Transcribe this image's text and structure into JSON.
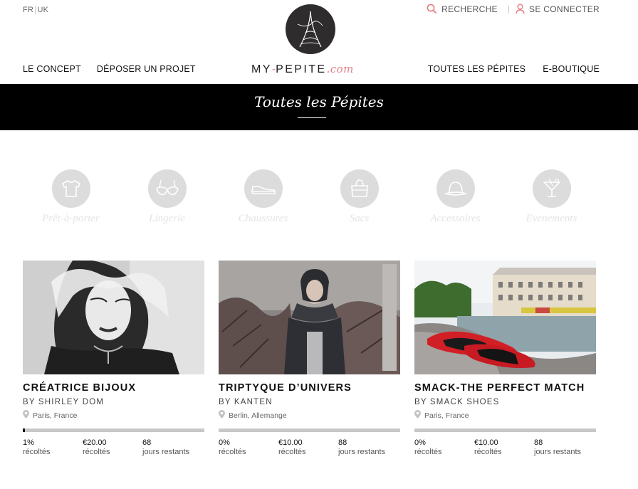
{
  "header": {
    "lang_fr": "FR",
    "lang_sep": "|",
    "lang_uk": "UK",
    "search_label": "RECHERCHE",
    "util_sep": "|",
    "login_label": "SE CONNECTER",
    "logo_main": "MY",
    "logo_dash": "-",
    "logo_rest": "PEPITE",
    "logo_com": ".com",
    "nav_left": [
      "LE CONCEPT",
      "DÉPOSER UN PROJET"
    ],
    "nav_right": [
      "TOUTES LES PÉPITES",
      "E-BOUTIQUE"
    ]
  },
  "banner": {
    "title": "Toutes les Pépites"
  },
  "categories": [
    {
      "label": "Prêt-à-porter",
      "icon": "tshirt-icon"
    },
    {
      "label": "Lingerie",
      "icon": "bra-icon"
    },
    {
      "label": "Chaussures",
      "icon": "shoe-icon"
    },
    {
      "label": "Sacs",
      "icon": "bag-icon"
    },
    {
      "label": "Accessoires",
      "icon": "hat-icon"
    },
    {
      "label": "Evenements",
      "icon": "cocktail-icon"
    }
  ],
  "projects": [
    {
      "title": "CRÉATRICE BIJOUX",
      "by": "BY SHIRLEY DOM",
      "location": "Paris, France",
      "progress": 0.01,
      "stats": [
        {
          "value": "1%",
          "label": "récoltés"
        },
        {
          "value": "€20.00",
          "label": "récoltés"
        },
        {
          "value": "68",
          "label": "jours restants"
        }
      ]
    },
    {
      "title": "TRIPTYQUE D’UNIVERS",
      "by": "BY KANTEN",
      "location": "Berlin, Allemange",
      "progress": 0,
      "stats": [
        {
          "value": "0%",
          "label": "récoltés"
        },
        {
          "value": "€10.00",
          "label": "récoltés"
        },
        {
          "value": "88",
          "label": "jours restants"
        }
      ]
    },
    {
      "title": "SMACK-THE PERFECT MATCH",
      "by": "BY SMACK SHOES",
      "location": "Paris, France",
      "progress": 0,
      "stats": [
        {
          "value": "0%",
          "label": "récoltés"
        },
        {
          "value": "€10.00",
          "label": "récoltés"
        },
        {
          "value": "88",
          "label": "jours restants"
        }
      ]
    }
  ],
  "colors": {
    "accent": "#e47f86",
    "banner": "#000000",
    "progress_track": "#c8c8c8",
    "progress_fill": "#111111"
  }
}
